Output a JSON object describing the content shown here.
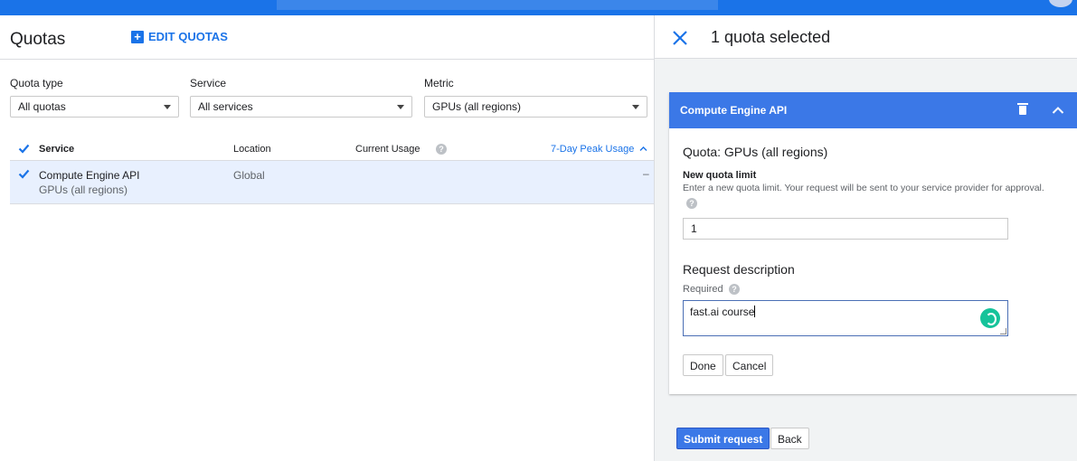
{
  "left": {
    "title": "Quotas",
    "edit_label": "EDIT QUOTAS",
    "filters": [
      {
        "label": "Quota type",
        "value": "All quotas"
      },
      {
        "label": "Service",
        "value": "All services"
      },
      {
        "label": "Metric",
        "value": "GPUs (all regions)"
      }
    ],
    "columns": {
      "service": "Service",
      "location": "Location",
      "current_usage": "Current Usage",
      "peak_usage": "7-Day Peak Usage"
    },
    "rows": [
      {
        "service": "Compute Engine API",
        "metric": "GPUs (all regions)",
        "location": "Global",
        "current_usage": "",
        "peak_usage": "–"
      }
    ]
  },
  "right": {
    "header_title": "1 quota selected",
    "card_title": "Compute Engine API",
    "quota_label": "Quota: GPUs (all regions)",
    "new_limit_label": "New quota limit",
    "new_limit_help": "Enter a new quota limit. Your request will be sent to your service provider for approval.",
    "new_limit_value": "1",
    "request_desc_label": "Request description",
    "required_label": "Required",
    "request_desc_value": "fast.ai course",
    "done_label": "Done",
    "cancel_label": "Cancel",
    "submit_label": "Submit request",
    "back_label": "Back"
  },
  "icons": {
    "close": "close-icon",
    "delete": "trash-icon",
    "collapse": "chevron-up-icon",
    "help": "help-icon",
    "add": "plus-icon"
  },
  "colors": {
    "accent": "#1a73e8",
    "card_header": "#3b78e7",
    "row_selected": "#e8f0fe",
    "grammar": "#15c39a"
  }
}
